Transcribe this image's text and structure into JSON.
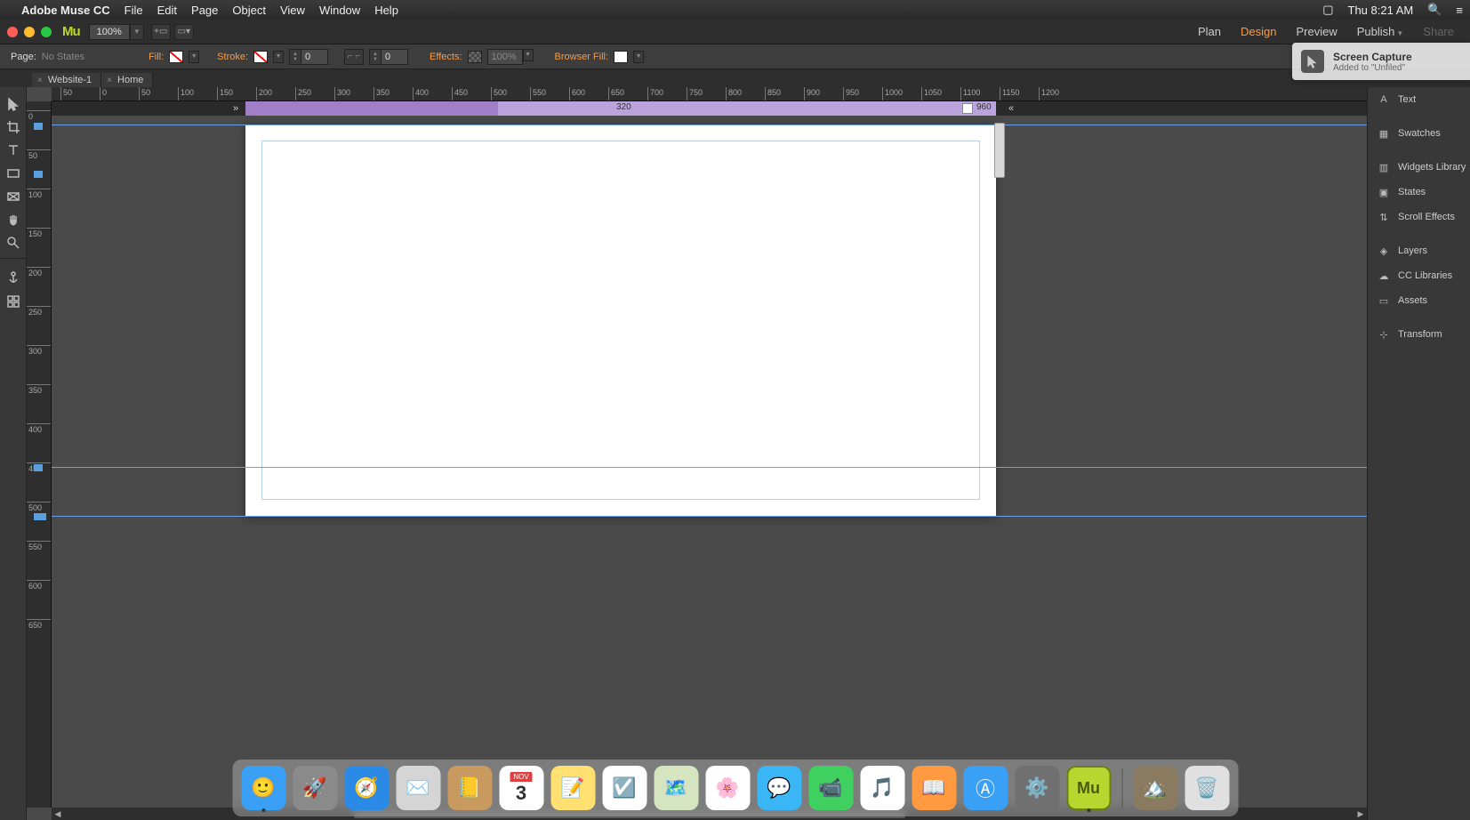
{
  "mac_menu": {
    "app_name": "Adobe Muse CC",
    "items": [
      "File",
      "Edit",
      "Page",
      "Object",
      "View",
      "Window",
      "Help"
    ],
    "clock": "Thu 8:21 AM"
  },
  "app_bar": {
    "logo": "Mu",
    "zoom": "100%",
    "modes": {
      "plan": "Plan",
      "design": "Design",
      "preview": "Preview",
      "publish": "Publish",
      "share": "Share"
    }
  },
  "props": {
    "page_label": "Page:",
    "page_state": "No States",
    "fill_label": "Fill:",
    "stroke_label": "Stroke:",
    "stroke_weight": "0",
    "corner_radius": "0",
    "effects_label": "Effects:",
    "opacity": "100%",
    "browser_fill_label": "Browser Fill:"
  },
  "tabs": [
    {
      "name": "Website-1"
    },
    {
      "name": "Home"
    }
  ],
  "breakpoints": {
    "min_label": "320",
    "max_label": "960"
  },
  "ruler_h": [
    "50",
    "0",
    "50",
    "100",
    "150",
    "200",
    "250",
    "300",
    "350",
    "400",
    "450",
    "500",
    "550",
    "600",
    "650",
    "700",
    "750",
    "800",
    "850",
    "900",
    "950",
    "1000",
    "1050",
    "1100",
    "1150",
    "1200"
  ],
  "ruler_v": [
    "0",
    "50",
    "100",
    "150",
    "200",
    "250",
    "300",
    "350",
    "400",
    "450",
    "500",
    "550",
    "600",
    "650"
  ],
  "panels": [
    "Text",
    "Swatches",
    "Widgets Library",
    "States",
    "Scroll Effects",
    "Layers",
    "CC Libraries",
    "Assets",
    "Transform"
  ],
  "toast": {
    "title": "Screen Capture",
    "sub": "Added to \"Unfiled\""
  },
  "dock": {
    "apps": [
      {
        "n": "Finder",
        "c": "#3aa0f5",
        "g": "🙂"
      },
      {
        "n": "Launchpad",
        "c": "#8a8a8a",
        "g": "🚀"
      },
      {
        "n": "Safari",
        "c": "#2a8ae5",
        "g": "🧭"
      },
      {
        "n": "Mail",
        "c": "#d5d5d5",
        "g": "✉️"
      },
      {
        "n": "Contacts",
        "c": "#c89a60",
        "g": "📒"
      },
      {
        "n": "Calendar",
        "c": "#fff",
        "g": "3",
        "badge": "NOV"
      },
      {
        "n": "Notes",
        "c": "#ffe070",
        "g": "📝"
      },
      {
        "n": "Reminders",
        "c": "#fff",
        "g": "☑️"
      },
      {
        "n": "Maps",
        "c": "#d5e5c0",
        "g": "🗺️"
      },
      {
        "n": "Photos",
        "c": "#fff",
        "g": "🌸"
      },
      {
        "n": "Messages",
        "c": "#3ab5f5",
        "g": "💬"
      },
      {
        "n": "FaceTime",
        "c": "#40d060",
        "g": "📹"
      },
      {
        "n": "iTunes",
        "c": "#fff",
        "g": "🎵"
      },
      {
        "n": "iBooks",
        "c": "#ff9a40",
        "g": "📖"
      },
      {
        "n": "AppStore",
        "c": "#3aa0f5",
        "g": "Ⓐ"
      },
      {
        "n": "Preferences",
        "c": "#707070",
        "g": "⚙️"
      },
      {
        "n": "Muse",
        "c": "#b8d62f",
        "g": "Mu"
      }
    ],
    "right": [
      {
        "n": "Folder",
        "c": "#8a7a60",
        "g": "🏔️"
      },
      {
        "n": "Trash",
        "c": "#e0e0e0",
        "g": "🗑️"
      }
    ],
    "running": [
      "Finder",
      "Muse"
    ]
  }
}
